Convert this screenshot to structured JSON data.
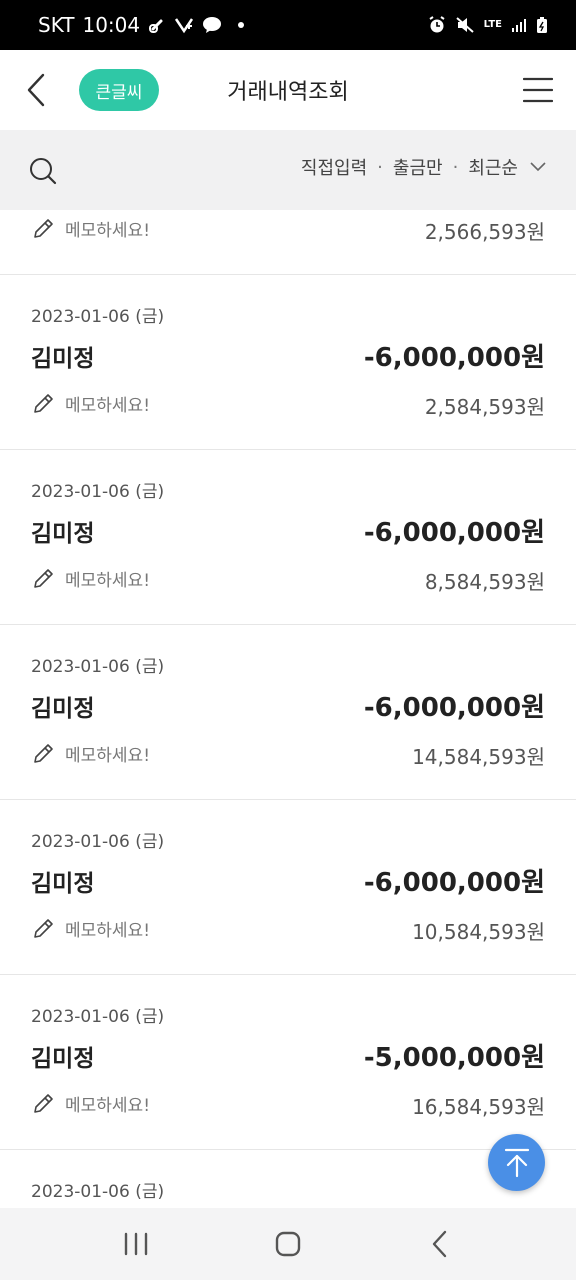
{
  "status_bar": {
    "carrier": "SKT",
    "time": "10:04",
    "network": "LTE"
  },
  "header": {
    "big_font_label": "큰글씨",
    "title": "거래내역조회"
  },
  "filter": {
    "options": [
      "직접입력",
      "출금만",
      "최근순"
    ],
    "separator": "·"
  },
  "partial_item": {
    "memo": "메모하세요!",
    "balance": "2,566,593원"
  },
  "transactions": [
    {
      "date": "2023-01-06 (금)",
      "name": "김미정",
      "amount": "-6,000,000원",
      "memo": "메모하세요!",
      "balance": "2,584,593원"
    },
    {
      "date": "2023-01-06 (금)",
      "name": "김미정",
      "amount": "-6,000,000원",
      "memo": "메모하세요!",
      "balance": "8,584,593원"
    },
    {
      "date": "2023-01-06 (금)",
      "name": "김미정",
      "amount": "-6,000,000원",
      "memo": "메모하세요!",
      "balance": "14,584,593원"
    },
    {
      "date": "2023-01-06 (금)",
      "name": "김미정",
      "amount": "-6,000,000원",
      "memo": "메모하세요!",
      "balance": "10,584,593원"
    },
    {
      "date": "2023-01-06 (금)",
      "name": "김미정",
      "amount": "-5,000,000원",
      "memo": "메모하세요!",
      "balance": "16,584,593원"
    }
  ],
  "last_partial": {
    "date": "2023-01-06 (금)"
  },
  "colors": {
    "accent": "#2fc8a6",
    "fab": "#4a8fe6",
    "filter_bg": "#f1f1f2"
  }
}
